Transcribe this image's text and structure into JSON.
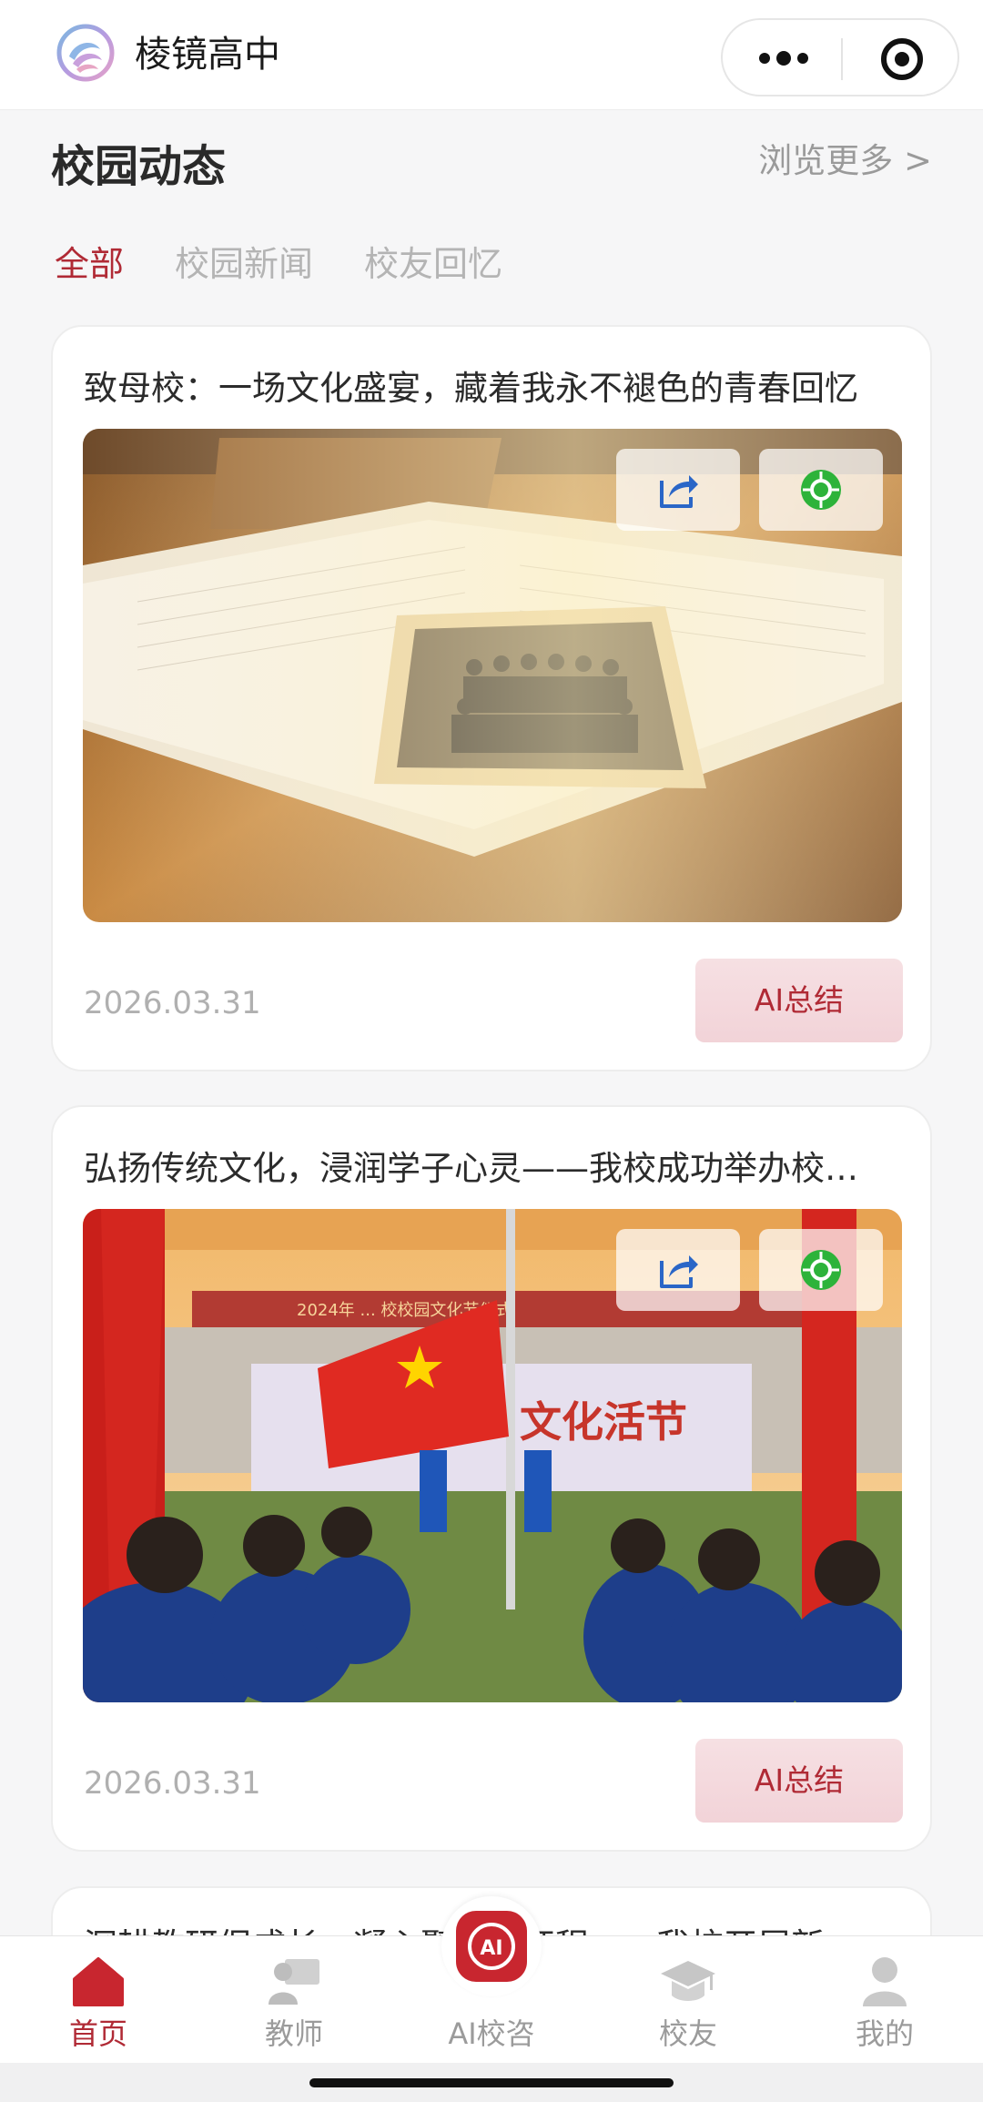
{
  "header": {
    "title": "棱镜高中"
  },
  "section": {
    "title": "校园动态",
    "more": "浏览更多 >"
  },
  "tabs": [
    {
      "label": "全部",
      "active": true
    },
    {
      "label": "校园新闻",
      "active": false
    },
    {
      "label": "校友回忆",
      "active": false
    }
  ],
  "cards": [
    {
      "title": "致母校：一场文化盛宴，藏着我永不褪色的青春回忆",
      "date": "2026.03.31",
      "ai_label": "AI总结"
    },
    {
      "title": "弘扬传统文化，浸润学子心灵——我校成功举办校…",
      "date": "2026.03.31",
      "ai_label": "AI总结",
      "image_banner": "2024年 ... 校校园文化节仪式",
      "image_backdrop": "文化活节"
    },
    {
      "title": "深耕教研促成长，凝心聚力新征程——我校开展新…"
    }
  ],
  "bottom_nav": [
    {
      "label": "首页",
      "icon": "home-icon",
      "active": true
    },
    {
      "label": "教师",
      "icon": "teacher-icon",
      "active": false
    },
    {
      "label": "AI校咨",
      "icon": "ai-chat-icon",
      "active": false
    },
    {
      "label": "校友",
      "icon": "graduation-cap-icon",
      "active": false
    },
    {
      "label": "我的",
      "icon": "user-icon",
      "active": false
    }
  ],
  "colors": {
    "accent": "#b02a35",
    "muted": "#9b9b9b",
    "background": "#f6f6f7"
  }
}
